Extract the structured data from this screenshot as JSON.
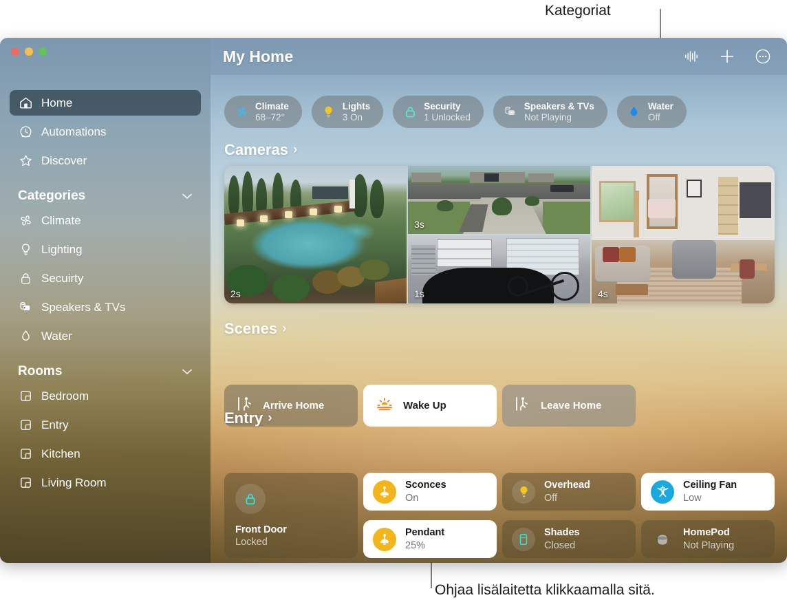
{
  "annotations": {
    "top": "Kategoriat",
    "bottom": "Ohjaa lisälaitetta klikkaamalla sitä."
  },
  "window": {
    "title": "My Home",
    "toolbar": [
      {
        "name": "audio-waveform-icon",
        "label": "Audio"
      },
      {
        "name": "plus-icon",
        "label": "Add"
      },
      {
        "name": "more-options-icon",
        "label": "More"
      }
    ]
  },
  "sidebar": {
    "nav": [
      {
        "label": "Home",
        "icon": "house-icon",
        "selected": true
      },
      {
        "label": "Automations",
        "icon": "clock-icon",
        "selected": false
      },
      {
        "label": "Discover",
        "icon": "star-icon",
        "selected": false
      }
    ],
    "categories_header": "Categories",
    "categories": [
      {
        "label": "Climate",
        "icon": "fan-icon"
      },
      {
        "label": "Lighting",
        "icon": "bulb-icon"
      },
      {
        "label": "Secuirty",
        "icon": "lock-icon"
      },
      {
        "label": "Speakers & TVs",
        "icon": "speaker-tv-icon"
      },
      {
        "label": "Water",
        "icon": "droplet-icon"
      }
    ],
    "rooms_header": "Rooms",
    "rooms": [
      {
        "label": "Bedroom",
        "icon": "room-icon"
      },
      {
        "label": "Entry",
        "icon": "room-icon"
      },
      {
        "label": "Kitchen",
        "icon": "room-icon"
      },
      {
        "label": "Living Room",
        "icon": "room-icon"
      }
    ]
  },
  "pills": [
    {
      "name": "Climate",
      "status": "68–72°",
      "icon": "fan-icon",
      "color": "#3fb8e8"
    },
    {
      "name": "Lights",
      "status": "3 On",
      "icon": "bulb-icon",
      "color": "#f5c518"
    },
    {
      "name": "Security",
      "status": "1 Unlocked",
      "icon": "lock-icon",
      "color": "#5fe3cf"
    },
    {
      "name": "Speakers & TVs",
      "status": "Not Playing",
      "icon": "speaker-tv-icon",
      "color": "#d9dde0"
    },
    {
      "name": "Water",
      "status": "Off",
      "icon": "droplet-icon",
      "color": "#1a8bf0"
    }
  ],
  "sections": {
    "cameras": "Cameras",
    "scenes": "Scenes",
    "entry": "Entry",
    "arrow": "›"
  },
  "cameras": [
    {
      "name": "pool-camera",
      "timestamp": "2s"
    },
    {
      "name": "driveway-camera",
      "timestamp": "3s"
    },
    {
      "name": "garage-camera",
      "timestamp": "1s"
    },
    {
      "name": "living-room-camera",
      "timestamp": "4s"
    }
  ],
  "scenes": [
    {
      "label": "Arrive Home",
      "icon": "walk-in-icon",
      "active": false
    },
    {
      "label": "Wake Up",
      "icon": "sunrise-icon",
      "active": true
    },
    {
      "label": "Leave Home",
      "icon": "walk-out-icon",
      "active": false
    }
  ],
  "entry_devices": {
    "lock": {
      "name": "Front Door",
      "status": "Locked",
      "icon": "lock-icon"
    },
    "tiles": [
      {
        "name": "Sconces",
        "status": "On",
        "icon": "sconce-icon",
        "on": true
      },
      {
        "name": "Overhead",
        "status": "Off",
        "icon": "bulb-icon",
        "on": false
      },
      {
        "name": "Ceiling Fan",
        "status": "Low",
        "icon": "fan-icon",
        "on": true
      },
      {
        "name": "Pendant",
        "status": "25%",
        "icon": "pendant-icon",
        "on": true
      },
      {
        "name": "Shades",
        "status": "Closed",
        "icon": "shade-icon",
        "on": false
      },
      {
        "name": "HomePod",
        "status": "Not Playing",
        "icon": "homepod-icon",
        "on": false
      }
    ]
  },
  "colors": {
    "amber": "#f3b519",
    "cyan": "#19a8e0",
    "teal": "#34e0d0",
    "orange": "#f07f18"
  }
}
